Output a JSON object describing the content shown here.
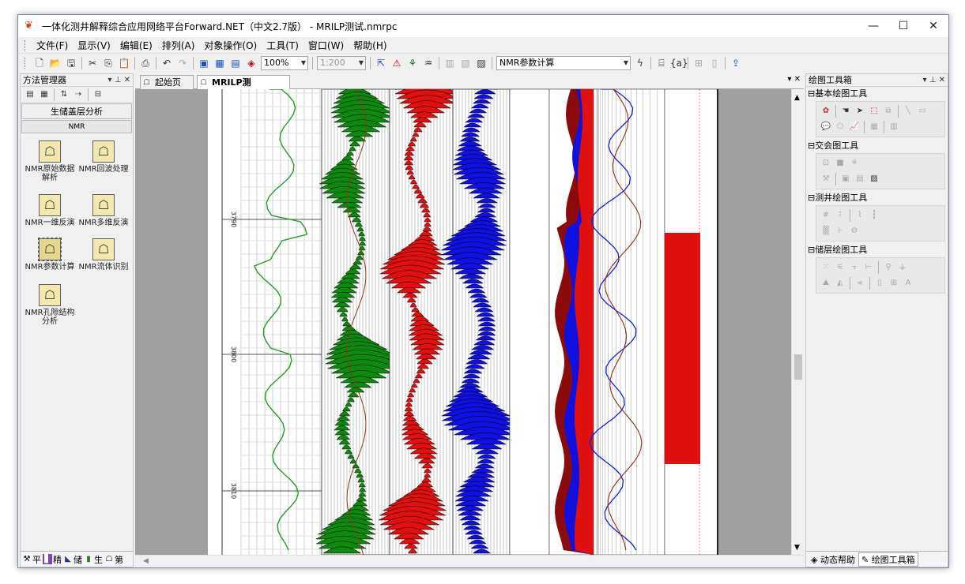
{
  "window": {
    "title": "一体化测井解释综合应用网络平台Forward.NET（中文2.7版） - MRILP测试.nmrpc",
    "minimize": "—",
    "maximize": "☐",
    "close": "✕"
  },
  "menu": [
    "文件(F)",
    "显示(V)",
    "编辑(E)",
    "排列(A)",
    "对象操作(O)",
    "工具(T)",
    "窗口(W)",
    "帮助(H)"
  ],
  "toolbar": {
    "zoom": "100%",
    "scale": "1:200",
    "method_select": "NMR参数计算",
    "curve_btn": "{a}"
  },
  "left_panel": {
    "title": "方法管理器",
    "section": "生储盖层分析",
    "subsection": "NMR",
    "methods": [
      {
        "label": "NMR原始数据解析"
      },
      {
        "label": "NMR回波处理"
      },
      {
        "label": "NMR一维反演"
      },
      {
        "label": "NMR多维反演"
      },
      {
        "label": "NMR参数计算"
      },
      {
        "label": "NMR流体识别"
      },
      {
        "label": "NMR孔隙结构分析"
      }
    ],
    "tabs": [
      "平",
      "精",
      "储",
      "生",
      "第"
    ]
  },
  "doc": {
    "tabs": [
      "起始页",
      "MRILP测试.nmrpc"
    ],
    "depth_labels": [
      "3790",
      "3800",
      "3810"
    ]
  },
  "right_panel": {
    "title": "绘图工具箱",
    "groups": [
      "基本绘图工具",
      "交会图工具",
      "测井绘图工具",
      "储层绘图工具"
    ],
    "tabs": [
      "动态帮助",
      "绘图工具箱"
    ]
  },
  "colors": {
    "green_track": "#0d8a0d",
    "red_track": "#e01010",
    "blue_track": "#1010e0",
    "darkred": "#8b0a0a"
  }
}
